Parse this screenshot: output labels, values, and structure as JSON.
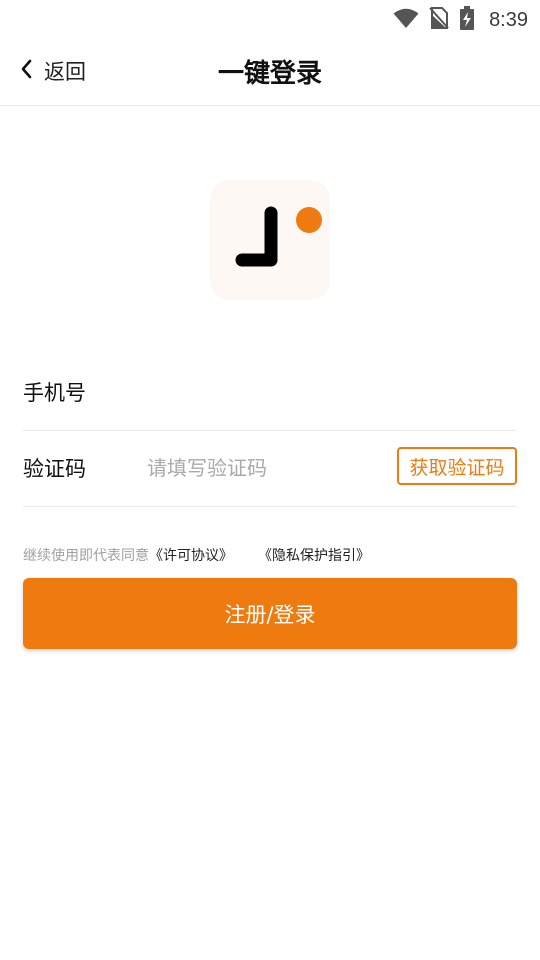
{
  "status_bar": {
    "time": "8:39",
    "icons": [
      "wifi-icon",
      "no-sim-icon",
      "battery-charging-icon"
    ]
  },
  "header": {
    "back_label": "返回",
    "title": "一键登录"
  },
  "logo": {
    "icon": "app-logo-j-icon",
    "accent_color": "#ef7a10"
  },
  "form": {
    "phone": {
      "label": "手机号",
      "value": "",
      "placeholder": ""
    },
    "code": {
      "label": "验证码",
      "value": "",
      "placeholder": "请填写验证码",
      "button_label": "获取验证码"
    }
  },
  "agreement": {
    "prefix": "继续使用即代表同意",
    "license_link": "《许可协议》",
    "privacy_link": "《隐私保护指引》"
  },
  "submit": {
    "label": "注册/登录"
  },
  "colors": {
    "accent": "#ef7a10",
    "placeholder": "#a9a9a9",
    "divider": "#ececec"
  }
}
